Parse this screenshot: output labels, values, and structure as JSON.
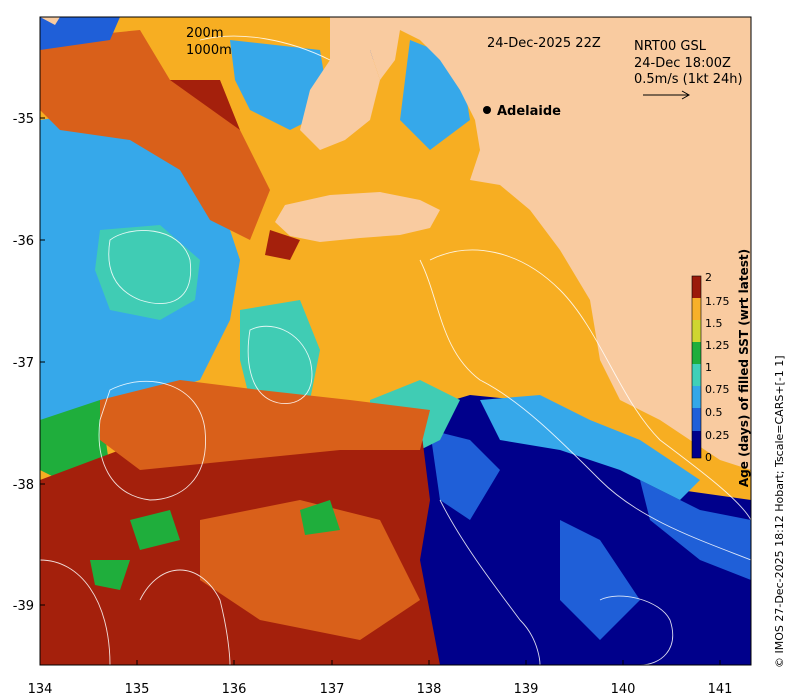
{
  "map": {
    "date_label": "24-Dec-2025 22Z",
    "model_label": "NRT00 GSL",
    "model_time": "24-Dec 18:00Z",
    "vector_scale": "0.5m/s (1kt 24h)",
    "contour_200": "200m",
    "contour_1000": "1000m",
    "city": "Adelaide",
    "credit": "© IMOS 27-Dec-2025 18:12 Hobart; Tscale=CARS+[-1 1]",
    "x_ticks": [
      "134",
      "135",
      "136",
      "137",
      "138",
      "139",
      "140",
      "141"
    ],
    "y_ticks": [
      "-35",
      "-36",
      "-37",
      "-38",
      "-39"
    ]
  },
  "colorbar": {
    "title": "Age (days) of filled SST (wrt latest)",
    "ticks": [
      "0",
      "0.25",
      "0.5",
      "0.75",
      "1",
      "1.25",
      "1.5",
      "1.75",
      "2"
    ],
    "colors": [
      "#00008b",
      "#1f5fd8",
      "#33a7e8",
      "#40d0b8",
      "#1fae3c",
      "#cfd630",
      "#f7b02a",
      "#d9631a",
      "#9b1a0a"
    ]
  },
  "palette": {
    "land": "#f9cba0",
    "age_0": "#00008b",
    "age_025": "#1f5fd8",
    "age_05": "#36a8ea",
    "age_075": "#40ccb4",
    "age_1": "#1fae3c",
    "age_15": "#f7ae22",
    "age_175": "#d9601a",
    "age_2": "#a4200c"
  }
}
